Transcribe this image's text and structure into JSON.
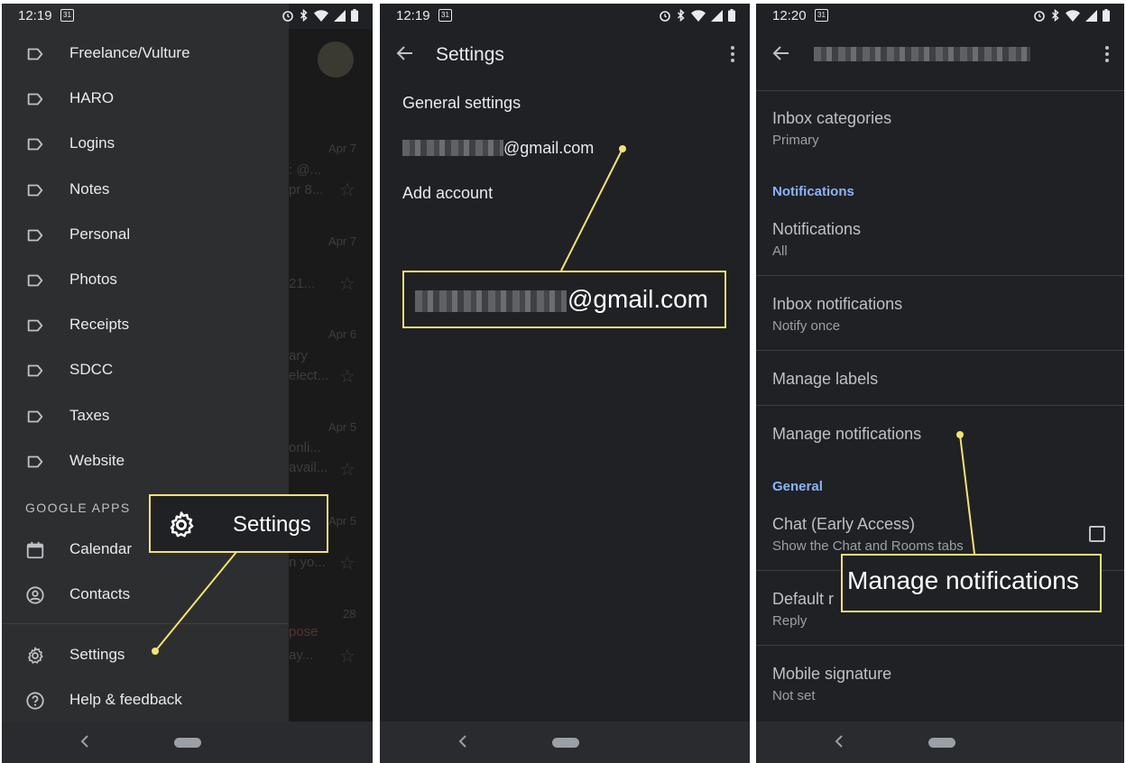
{
  "panel1": {
    "status": {
      "time": "12:19",
      "cal_day": "31"
    },
    "drawer_items": [
      {
        "label": "Freelance/Vulture",
        "icon": "label-icon"
      },
      {
        "label": "HARO",
        "icon": "label-icon"
      },
      {
        "label": "Logins",
        "icon": "label-icon"
      },
      {
        "label": "Notes",
        "icon": "label-icon"
      },
      {
        "label": "Personal",
        "icon": "label-icon"
      },
      {
        "label": "Photos",
        "icon": "label-icon"
      },
      {
        "label": "Receipts",
        "icon": "label-icon"
      },
      {
        "label": "SDCC",
        "icon": "label-icon"
      },
      {
        "label": "Taxes",
        "icon": "label-icon"
      },
      {
        "label": "Website",
        "icon": "label-icon"
      }
    ],
    "google_apps_header": "GOOGLE APPS",
    "apps": [
      {
        "label": "Calendar",
        "icon": "calendar-icon"
      },
      {
        "label": "Contacts",
        "icon": "contacts-icon"
      }
    ],
    "footer_items": [
      {
        "label": "Settings",
        "icon": "gear-icon"
      },
      {
        "label": "Help & feedback",
        "icon": "help-icon"
      }
    ],
    "background_fragments": {
      "dates": [
        "Apr 7",
        "Apr 7",
        "Apr 6",
        "Apr 5",
        "Apr 5",
        "28"
      ],
      "snippets": [
        ": @...",
        "pr 8...",
        "21...",
        "ary",
        "elect...",
        "onli...",
        "avail...",
        "n yo...",
        "ay..."
      ],
      "compose": "pose"
    },
    "callout": "Settings"
  },
  "panel2": {
    "status": {
      "time": "12:19",
      "cal_day": "31"
    },
    "title": "Settings",
    "items": {
      "general": "General settings",
      "account_suffix": "@gmail.com",
      "add_account": "Add account"
    },
    "callout_suffix": "@gmail.com"
  },
  "panel3": {
    "status": {
      "time": "12:20",
      "cal_day": "31"
    },
    "rows": {
      "inbox_categories": {
        "title": "Inbox categories",
        "sub": "Primary"
      },
      "notifications_section": "Notifications",
      "notifications": {
        "title": "Notifications",
        "sub": "All"
      },
      "inbox_notifications": {
        "title": "Inbox notifications",
        "sub": "Notify once"
      },
      "manage_labels": "Manage labels",
      "manage_notifications": "Manage notifications",
      "general_section": "General",
      "chat": {
        "title": "Chat (Early Access)",
        "sub": "Show the Chat and Rooms tabs"
      },
      "default_reply": {
        "title": "Default r",
        "sub": "Reply"
      },
      "mobile_signature": {
        "title": "Mobile signature",
        "sub": "Not set"
      }
    },
    "callout": "Manage notifications"
  },
  "colors": {
    "background": "#202124",
    "drawer": "#2d2e30",
    "callout": "#f2e46b",
    "section_blue": "#8ab4f8"
  }
}
